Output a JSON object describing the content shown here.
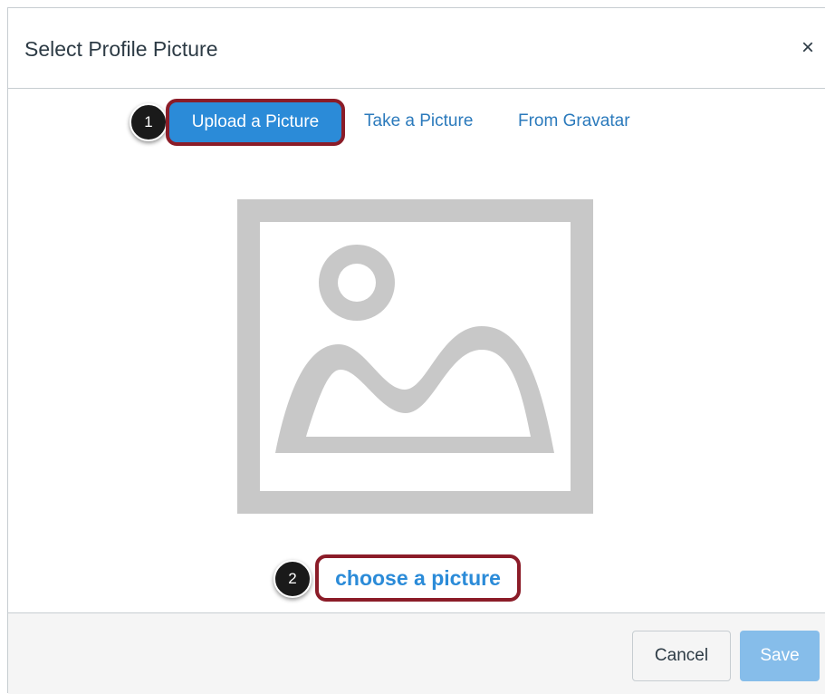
{
  "dialog": {
    "title": "Select Profile Picture",
    "close_label": "×"
  },
  "tabs": [
    {
      "label": "Upload a Picture",
      "active": true
    },
    {
      "label": "Take a Picture",
      "active": false
    },
    {
      "label": "From Gravatar",
      "active": false
    }
  ],
  "callouts": {
    "step1": "1",
    "step2": "2"
  },
  "upload": {
    "choose_label": "choose a picture",
    "placeholder_icon": "image-placeholder-icon"
  },
  "footer": {
    "cancel_label": "Cancel",
    "save_label": "Save"
  },
  "colors": {
    "accent": "#2b8bd8",
    "highlight_outline": "#8b1c28",
    "save_disabled": "#86bdea",
    "placeholder_gray": "#c8c8c8"
  }
}
